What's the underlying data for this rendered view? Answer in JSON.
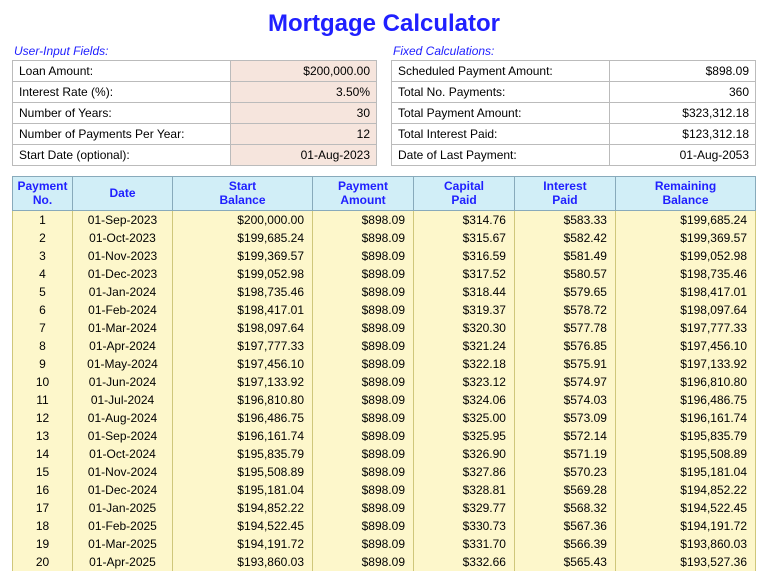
{
  "title": "Mortgage Calculator",
  "inputs": {
    "section_title": "User-Input Fields:",
    "rows": [
      {
        "label": "Loan Amount:",
        "value": "$200,000.00"
      },
      {
        "label": "Interest Rate (%):",
        "value": "3.50%"
      },
      {
        "label": "Number of Years:",
        "value": "30"
      },
      {
        "label": "Number of  Payments Per Year:",
        "value": "12"
      },
      {
        "label": "Start Date (optional):",
        "value": "01-Aug-2023"
      }
    ]
  },
  "fixed": {
    "section_title": "Fixed Calculations:",
    "rows": [
      {
        "label": "Scheduled Payment Amount:",
        "value": "$898.09"
      },
      {
        "label": "Total No. Payments:",
        "value": "360"
      },
      {
        "label": "Total Payment Amount:",
        "value": "$323,312.18"
      },
      {
        "label": "Total Interest Paid:",
        "value": "$123,312.18"
      },
      {
        "label": "Date of Last Payment:",
        "value": "01-Aug-2053"
      }
    ]
  },
  "schedule": {
    "headers": {
      "no": [
        "Payment",
        "No."
      ],
      "date": [
        "Date"
      ],
      "start": [
        "Start",
        "Balance"
      ],
      "amount": [
        "Payment",
        "Amount"
      ],
      "capital": [
        "Capital",
        "Paid"
      ],
      "interest": [
        "Interest",
        "Paid"
      ],
      "remaining": [
        "Remaining",
        "Balance"
      ]
    },
    "rows": [
      {
        "no": "1",
        "date": "01-Sep-2023",
        "start": "$200,000.00",
        "amount": "$898.09",
        "capital": "$314.76",
        "interest": "$583.33",
        "remaining": "$199,685.24"
      },
      {
        "no": "2",
        "date": "01-Oct-2023",
        "start": "$199,685.24",
        "amount": "$898.09",
        "capital": "$315.67",
        "interest": "$582.42",
        "remaining": "$199,369.57"
      },
      {
        "no": "3",
        "date": "01-Nov-2023",
        "start": "$199,369.57",
        "amount": "$898.09",
        "capital": "$316.59",
        "interest": "$581.49",
        "remaining": "$199,052.98"
      },
      {
        "no": "4",
        "date": "01-Dec-2023",
        "start": "$199,052.98",
        "amount": "$898.09",
        "capital": "$317.52",
        "interest": "$580.57",
        "remaining": "$198,735.46"
      },
      {
        "no": "5",
        "date": "01-Jan-2024",
        "start": "$198,735.46",
        "amount": "$898.09",
        "capital": "$318.44",
        "interest": "$579.65",
        "remaining": "$198,417.01"
      },
      {
        "no": "6",
        "date": "01-Feb-2024",
        "start": "$198,417.01",
        "amount": "$898.09",
        "capital": "$319.37",
        "interest": "$578.72",
        "remaining": "$198,097.64"
      },
      {
        "no": "7",
        "date": "01-Mar-2024",
        "start": "$198,097.64",
        "amount": "$898.09",
        "capital": "$320.30",
        "interest": "$577.78",
        "remaining": "$197,777.33"
      },
      {
        "no": "8",
        "date": "01-Apr-2024",
        "start": "$197,777.33",
        "amount": "$898.09",
        "capital": "$321.24",
        "interest": "$576.85",
        "remaining": "$197,456.10"
      },
      {
        "no": "9",
        "date": "01-May-2024",
        "start": "$197,456.10",
        "amount": "$898.09",
        "capital": "$322.18",
        "interest": "$575.91",
        "remaining": "$197,133.92"
      },
      {
        "no": "10",
        "date": "01-Jun-2024",
        "start": "$197,133.92",
        "amount": "$898.09",
        "capital": "$323.12",
        "interest": "$574.97",
        "remaining": "$196,810.80"
      },
      {
        "no": "11",
        "date": "01-Jul-2024",
        "start": "$196,810.80",
        "amount": "$898.09",
        "capital": "$324.06",
        "interest": "$574.03",
        "remaining": "$196,486.75"
      },
      {
        "no": "12",
        "date": "01-Aug-2024",
        "start": "$196,486.75",
        "amount": "$898.09",
        "capital": "$325.00",
        "interest": "$573.09",
        "remaining": "$196,161.74"
      },
      {
        "no": "13",
        "date": "01-Sep-2024",
        "start": "$196,161.74",
        "amount": "$898.09",
        "capital": "$325.95",
        "interest": "$572.14",
        "remaining": "$195,835.79"
      },
      {
        "no": "14",
        "date": "01-Oct-2024",
        "start": "$195,835.79",
        "amount": "$898.09",
        "capital": "$326.90",
        "interest": "$571.19",
        "remaining": "$195,508.89"
      },
      {
        "no": "15",
        "date": "01-Nov-2024",
        "start": "$195,508.89",
        "amount": "$898.09",
        "capital": "$327.86",
        "interest": "$570.23",
        "remaining": "$195,181.04"
      },
      {
        "no": "16",
        "date": "01-Dec-2024",
        "start": "$195,181.04",
        "amount": "$898.09",
        "capital": "$328.81",
        "interest": "$569.28",
        "remaining": "$194,852.22"
      },
      {
        "no": "17",
        "date": "01-Jan-2025",
        "start": "$194,852.22",
        "amount": "$898.09",
        "capital": "$329.77",
        "interest": "$568.32",
        "remaining": "$194,522.45"
      },
      {
        "no": "18",
        "date": "01-Feb-2025",
        "start": "$194,522.45",
        "amount": "$898.09",
        "capital": "$330.73",
        "interest": "$567.36",
        "remaining": "$194,191.72"
      },
      {
        "no": "19",
        "date": "01-Mar-2025",
        "start": "$194,191.72",
        "amount": "$898.09",
        "capital": "$331.70",
        "interest": "$566.39",
        "remaining": "$193,860.03"
      },
      {
        "no": "20",
        "date": "01-Apr-2025",
        "start": "$193,860.03",
        "amount": "$898.09",
        "capital": "$332.66",
        "interest": "$565.43",
        "remaining": "$193,527.36"
      }
    ]
  }
}
